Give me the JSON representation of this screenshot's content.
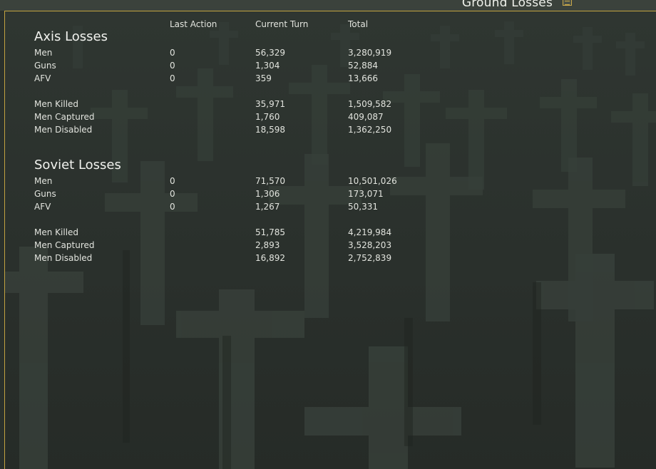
{
  "window": {
    "title": "Ground Losses",
    "icon": "report-icon"
  },
  "columns": {
    "last_action": "Last Action",
    "current_turn": "Current Turn",
    "total": "Total"
  },
  "axis": {
    "title": "Axis Losses",
    "rows": [
      {
        "label": "Men",
        "last_action": "0",
        "current_turn": "56,329",
        "total": "3,280,919"
      },
      {
        "label": "Guns",
        "last_action": "0",
        "current_turn": "1,304",
        "total": "52,884"
      },
      {
        "label": "AFV",
        "last_action": "0",
        "current_turn": "359",
        "total": "13,666"
      },
      {
        "label": "Men Killed",
        "last_action": "",
        "current_turn": "35,971",
        "total": "1,509,582"
      },
      {
        "label": "Men Captured",
        "last_action": "",
        "current_turn": "1,760",
        "total": "409,087"
      },
      {
        "label": "Men Disabled",
        "last_action": "",
        "current_turn": "18,598",
        "total": "1,362,250"
      }
    ]
  },
  "soviet": {
    "title": "Soviet Losses",
    "rows": [
      {
        "label": "Men",
        "last_action": "0",
        "current_turn": "71,570",
        "total": "10,501,026"
      },
      {
        "label": "Guns",
        "last_action": "0",
        "current_turn": "1,306",
        "total": "173,071"
      },
      {
        "label": "AFV",
        "last_action": "0",
        "current_turn": "1,267",
        "total": "50,331"
      },
      {
        "label": "Men Killed",
        "last_action": "",
        "current_turn": "51,785",
        "total": "4,219,984"
      },
      {
        "label": "Men Captured",
        "last_action": "",
        "current_turn": "2,893",
        "total": "3,528,203"
      },
      {
        "label": "Men Disabled",
        "last_action": "",
        "current_turn": "16,892",
        "total": "2,752,839"
      }
    ]
  },
  "colors": {
    "frame_border": "#c2a240",
    "background": "#2c322e",
    "text": "#e2e4de"
  }
}
